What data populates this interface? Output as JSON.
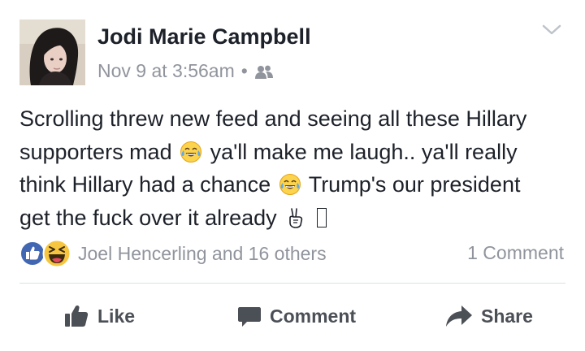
{
  "post": {
    "author": "Jodi Marie Campbell",
    "timestamp": "Nov 9 at 3:56am",
    "separator": "•",
    "audience_icon": "friends-icon",
    "menu_icon": "chevron-down-icon",
    "text_lines": [
      {
        "a": "Scrolling threw new feed and seeing all these Hillary",
        "b": ""
      },
      {
        "a": "supporters mad",
        "emoji": "tears-of-joy-emoji",
        "b": "ya'll make me laugh.. ya'll really"
      },
      {
        "a": "think Hillary had a chance",
        "emoji": "tears-of-joy-emoji",
        "b": "Trump's our president"
      },
      {
        "a": "get the fuck over it already",
        "emoji": "victory-hand-emoji",
        "b": ""
      }
    ]
  },
  "reactions": {
    "icons": [
      "like-reaction-icon",
      "haha-reaction-icon"
    ],
    "summary": "Joel Hencerling and 16 others",
    "comments": "1 Comment"
  },
  "actions": {
    "like": "Like",
    "comment": "Comment",
    "share": "Share"
  },
  "colors": {
    "text": "#1d2129",
    "secondary": "#90949c",
    "action": "#4b4f56",
    "like_blue": "#4267b2",
    "haha_yellow": "#f7c640",
    "divider": "#dddfe2"
  }
}
